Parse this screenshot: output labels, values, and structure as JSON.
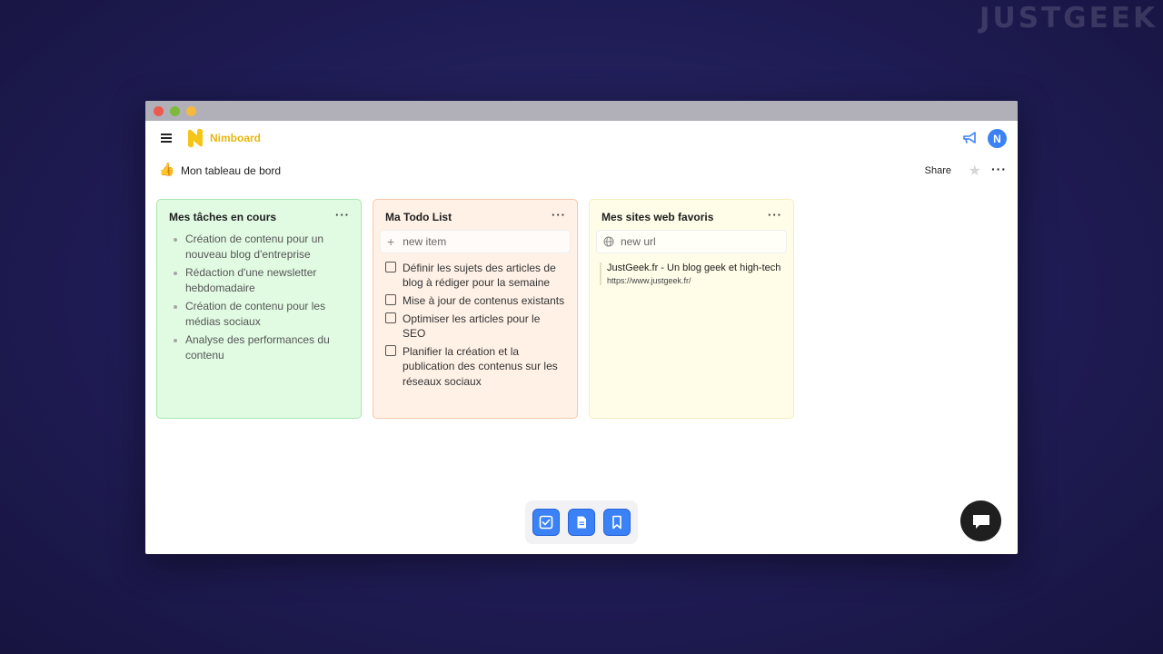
{
  "watermark": "JUSTGEEK",
  "app": {
    "name": "Nimboard",
    "avatar_initial": "N",
    "brand_color": "#e8b710",
    "accent_color": "#3b82f6"
  },
  "board": {
    "emoji": "👍",
    "title": "Mon tableau de bord",
    "share_label": "Share",
    "more_label": "···"
  },
  "cards": {
    "tasks": {
      "title": "Mes tâches en cours",
      "menu": "···",
      "items": [
        "Création de contenu pour un nouveau blog d'entreprise",
        "Rédaction d'une newsletter hebdomadaire",
        "Création de contenu pour les médias sociaux",
        "Analyse des performances du contenu"
      ]
    },
    "todo": {
      "title": "Ma Todo List",
      "menu": "···",
      "placeholder": "new item",
      "items": [
        "Définir les sujets des articles de blog à rédiger pour la semaine",
        "Mise à jour de contenus existants",
        "Optimiser les articles pour le SEO",
        "Planifier la création et la publication des contenus sur les réseaux sociaux"
      ]
    },
    "sites": {
      "title": "Mes sites web favoris",
      "menu": "···",
      "placeholder": "new url",
      "links": [
        {
          "title": "JustGeek.fr - Un blog geek et high-tech",
          "url": "https://www.justgeek.fr/"
        }
      ]
    }
  },
  "icons": {
    "menu": "hamburger-icon",
    "announce": "megaphone-icon",
    "star": "star-icon",
    "dock": [
      "checkbox-icon",
      "document-icon",
      "bookmark-icon"
    ],
    "chat": "chat-bubble-icon"
  }
}
